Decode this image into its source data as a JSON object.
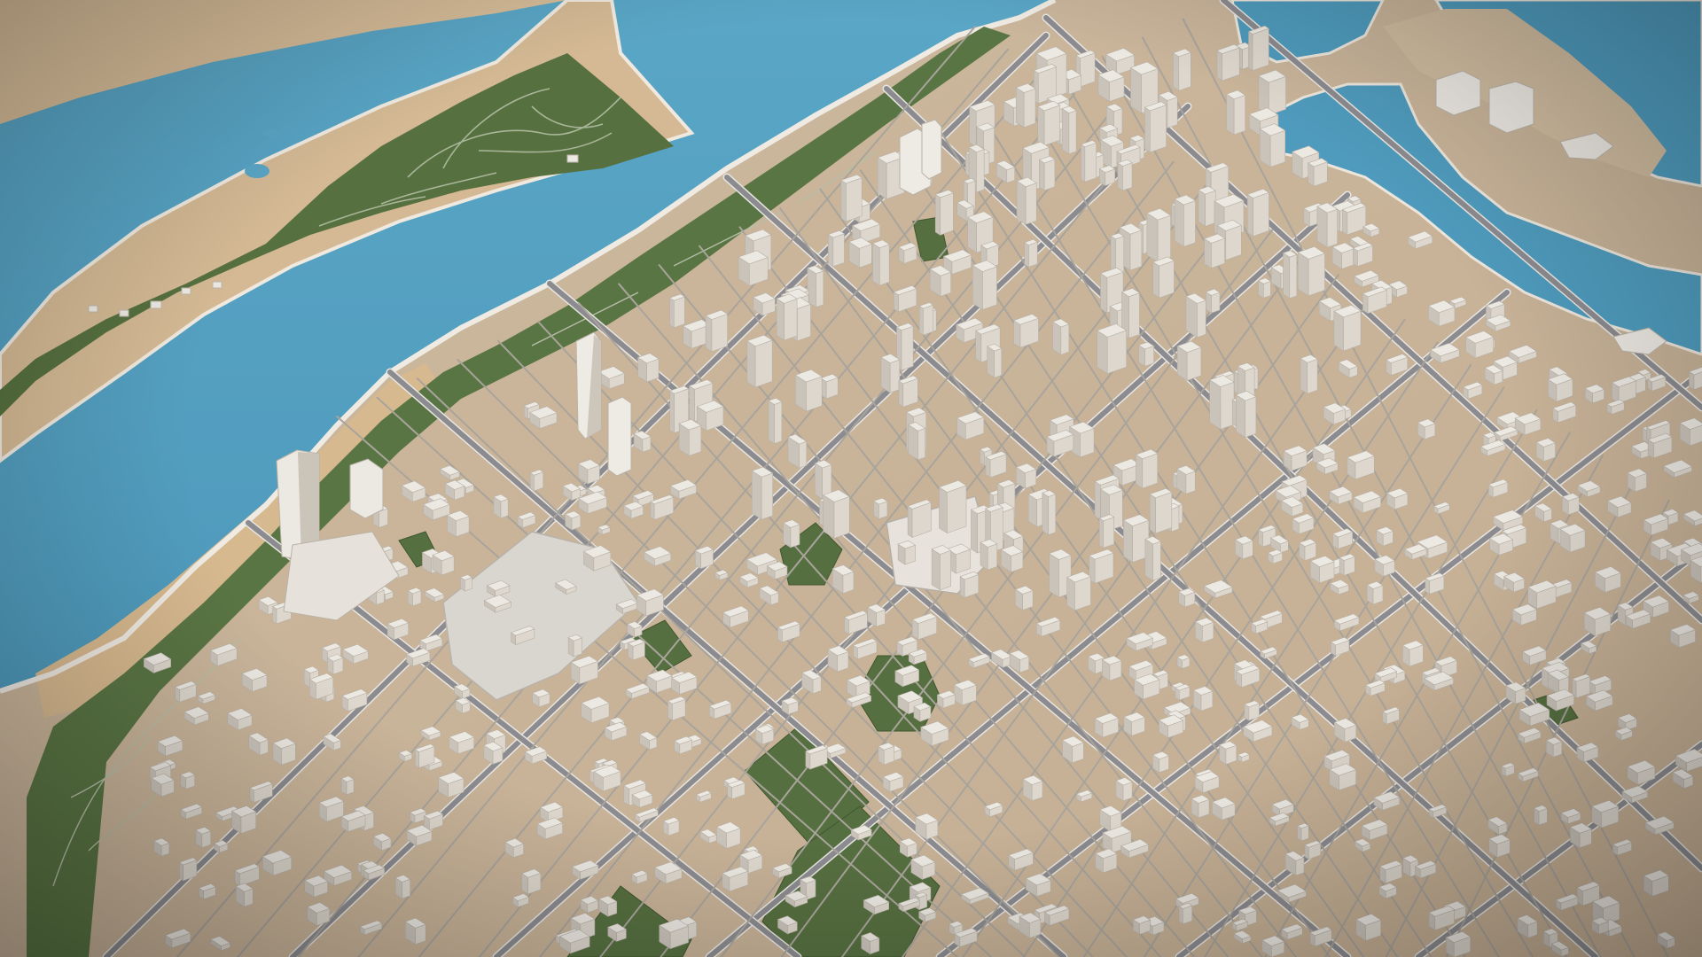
{
  "map": {
    "style": "3d-city-model",
    "colors": {
      "water": "#4f9bbd",
      "water_dark": "#3f88aa",
      "land": "#c9b49a",
      "sand": "#d2b794",
      "shore": "#eae6df",
      "park": "#566f40",
      "park_light": "#6a8451",
      "road": "#8c8c90",
      "road_edge": "#e8e6e2",
      "building": "#ece8e2",
      "building_side": "#c9c3ba",
      "building_shadow": "#9c9488",
      "plaza": "#d8d5ce"
    },
    "features": [
      "river",
      "river-island-park",
      "riverfront-parks",
      "downtown-towers",
      "street-grid",
      "city-blocks",
      "port-basins",
      "green-fields"
    ]
  }
}
